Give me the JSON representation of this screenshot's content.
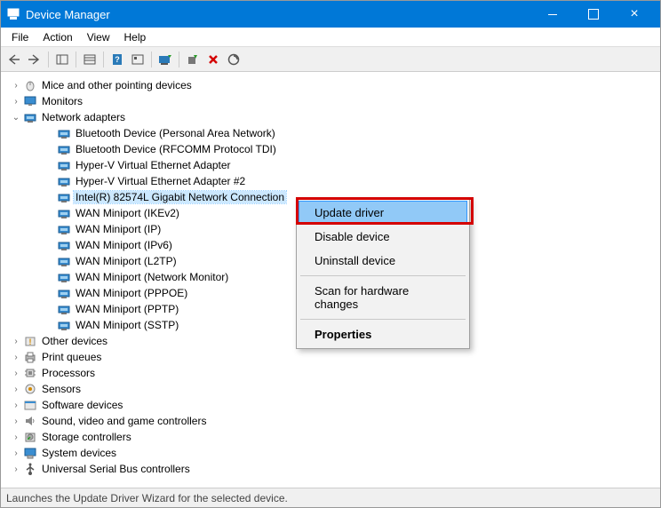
{
  "titlebar": {
    "title": "Device Manager"
  },
  "menubar": {
    "items": [
      "File",
      "Action",
      "View",
      "Help"
    ]
  },
  "tree": {
    "categories": [
      {
        "icon": "mouse",
        "label": "Mice and other pointing devices",
        "expanded": false
      },
      {
        "icon": "monitor",
        "label": "Monitors",
        "expanded": false
      },
      {
        "icon": "network",
        "label": "Network adapters",
        "expanded": true,
        "children": [
          {
            "icon": "network",
            "label": "Bluetooth Device (Personal Area Network)"
          },
          {
            "icon": "network",
            "label": "Bluetooth Device (RFCOMM Protocol TDI)"
          },
          {
            "icon": "network",
            "label": "Hyper-V Virtual Ethernet Adapter"
          },
          {
            "icon": "network",
            "label": "Hyper-V Virtual Ethernet Adapter #2"
          },
          {
            "icon": "network",
            "label": "Intel(R) 82574L Gigabit Network Connection",
            "selected": true
          },
          {
            "icon": "network",
            "label": "WAN Miniport (IKEv2)"
          },
          {
            "icon": "network",
            "label": "WAN Miniport (IP)"
          },
          {
            "icon": "network",
            "label": "WAN Miniport (IPv6)"
          },
          {
            "icon": "network",
            "label": "WAN Miniport (L2TP)"
          },
          {
            "icon": "network",
            "label": "WAN Miniport (Network Monitor)"
          },
          {
            "icon": "network",
            "label": "WAN Miniport (PPPOE)"
          },
          {
            "icon": "network",
            "label": "WAN Miniport (PPTP)"
          },
          {
            "icon": "network",
            "label": "WAN Miniport (SSTP)"
          }
        ]
      },
      {
        "icon": "other",
        "label": "Other devices",
        "expanded": false
      },
      {
        "icon": "printer",
        "label": "Print queues",
        "expanded": false
      },
      {
        "icon": "cpu",
        "label": "Processors",
        "expanded": false
      },
      {
        "icon": "sensor",
        "label": "Sensors",
        "expanded": false
      },
      {
        "icon": "software",
        "label": "Software devices",
        "expanded": false
      },
      {
        "icon": "audio",
        "label": "Sound, video and game controllers",
        "expanded": false
      },
      {
        "icon": "storage",
        "label": "Storage controllers",
        "expanded": false
      },
      {
        "icon": "system",
        "label": "System devices",
        "expanded": false
      },
      {
        "icon": "usb",
        "label": "Universal Serial Bus controllers",
        "expanded": false
      }
    ]
  },
  "context_menu": {
    "items": [
      {
        "label": "Update driver",
        "highlight": true
      },
      {
        "label": "Disable device"
      },
      {
        "label": "Uninstall device"
      },
      {
        "sep": true
      },
      {
        "label": "Scan for hardware changes"
      },
      {
        "sep": true
      },
      {
        "label": "Properties",
        "bold": true
      }
    ]
  },
  "statusbar": {
    "text": "Launches the Update Driver Wizard for the selected device."
  }
}
